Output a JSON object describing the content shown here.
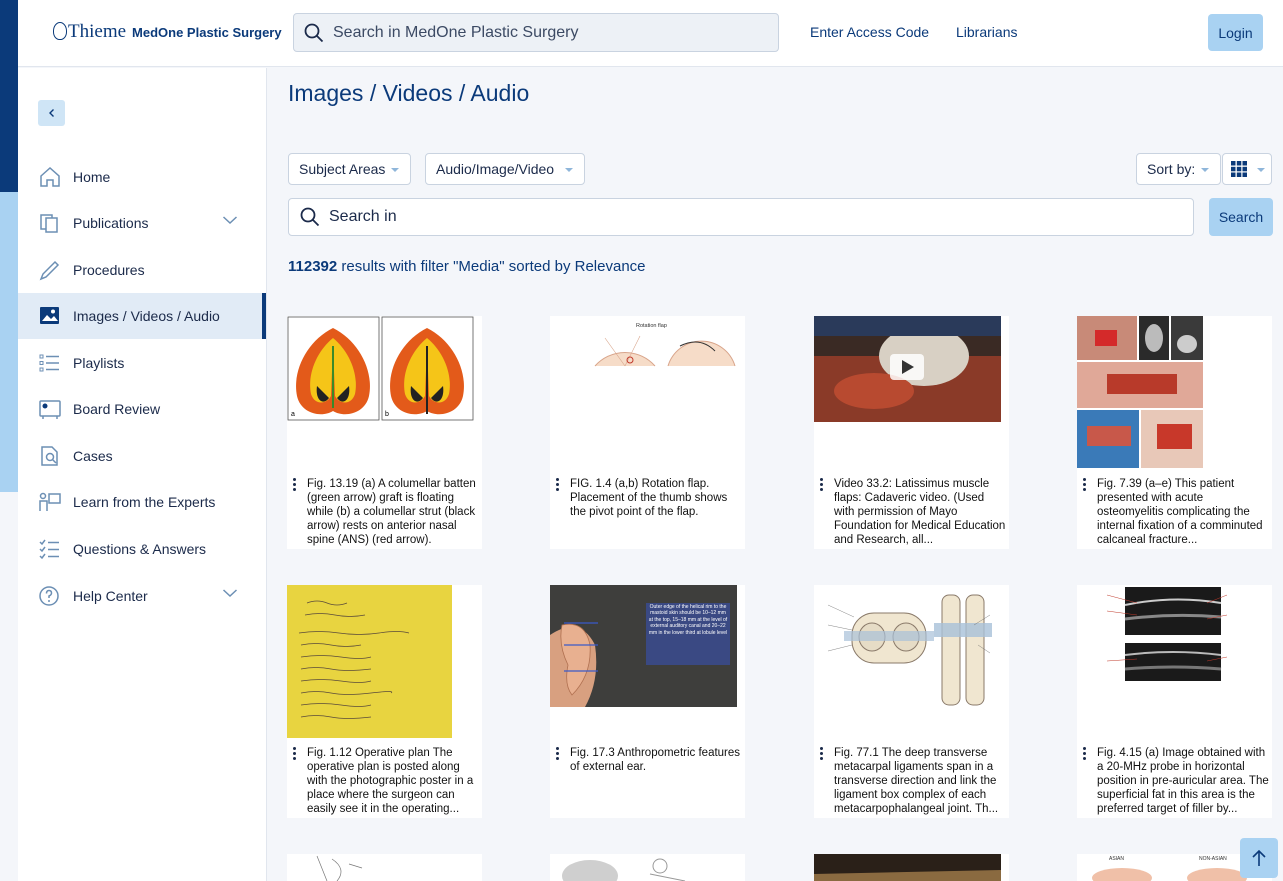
{
  "header": {
    "logo_brand": "Thieme",
    "logo_product": "MedOne Plastic Surgery",
    "search_placeholder": "Search in MedOne Plastic Surgery",
    "links": [
      "Enter Access Code",
      "Librarians"
    ],
    "login_label": "Login"
  },
  "sidebar": {
    "collapse_icon": "chevron-left-icon",
    "items": [
      {
        "label": "Home",
        "icon": "home-icon"
      },
      {
        "label": "Publications",
        "icon": "publications-icon",
        "expandable": true
      },
      {
        "label": "Procedures",
        "icon": "scalpel-icon"
      },
      {
        "label": "Images / Videos / Audio",
        "icon": "media-icon",
        "active": true
      },
      {
        "label": "Playlists",
        "icon": "list-icon"
      },
      {
        "label": "Board Review",
        "icon": "board-review-icon"
      },
      {
        "label": "Cases",
        "icon": "cases-icon"
      },
      {
        "label": "Learn from the Experts",
        "icon": "presenter-icon"
      },
      {
        "label": "Questions & Answers",
        "icon": "checklist-icon"
      },
      {
        "label": "Help Center",
        "icon": "help-icon",
        "expandable": true
      }
    ]
  },
  "main": {
    "title": "Images / Videos / Audio",
    "filters": [
      "Subject Areas",
      "Audio/Image/Video"
    ],
    "sort_label": "Sort by:",
    "view_icon": "grid-view-icon",
    "search_placeholder": "Search in",
    "search_button": "Search",
    "results_count": "112392",
    "results_text": " results with filter \"Media\" sorted by Relevance",
    "cards": [
      {
        "caption": "Fig. 13.19 (a) A columellar batten (green arrow) graft is floating while (b) a columellar strut (black arrow) rests on anterior nasal spine (ANS) (red arrow)."
      },
      {
        "caption": "FIG. 1.4 (a,b) Rotation flap. Placement of the thumb shows the pivot point of the flap."
      },
      {
        "caption": "Video 33.2: Latissimus muscle flaps: Cadaveric video. (Used with permission of Mayo Foundation for Medical Education and Research, all..."
      },
      {
        "caption": "Fig. 7.39 (a–e) This patient presented with acute osteomyelitis complicating the internal fixation of a comminuted calcaneal fracture..."
      },
      {
        "caption": "Fig. 1.12 Operative plan The operative plan is posted along with the photographic poster in a place where the surgeon can easily see it in the operating..."
      },
      {
        "caption": "Fig. 17.3 Anthropometric features of external ear."
      },
      {
        "caption": "Fig. 77.1 The deep transverse metacarpal ligaments span in a transverse direction and link the ligament box complex of each metacarpophalangeal joint. Th..."
      },
      {
        "caption": "Fig. 4.15 (a) Image obtained with a 20-MHz probe in horizontal position in pre-auricular area. The superficial fat in this area is the preferred target of filler by..."
      }
    ],
    "thumb_labels": {
      "rotation_flap_title": "Rotation flap",
      "ear_overlay": "Outer edge of the helical rim to the mastoid skin should be 10–12 mm at the top, 15–18 mm at the level of external auditory canal and 20–22 mm in the lower third at lobule level",
      "partial_asian": "ASIAN",
      "partial_nonasian": "NON-ASIAN"
    }
  }
}
